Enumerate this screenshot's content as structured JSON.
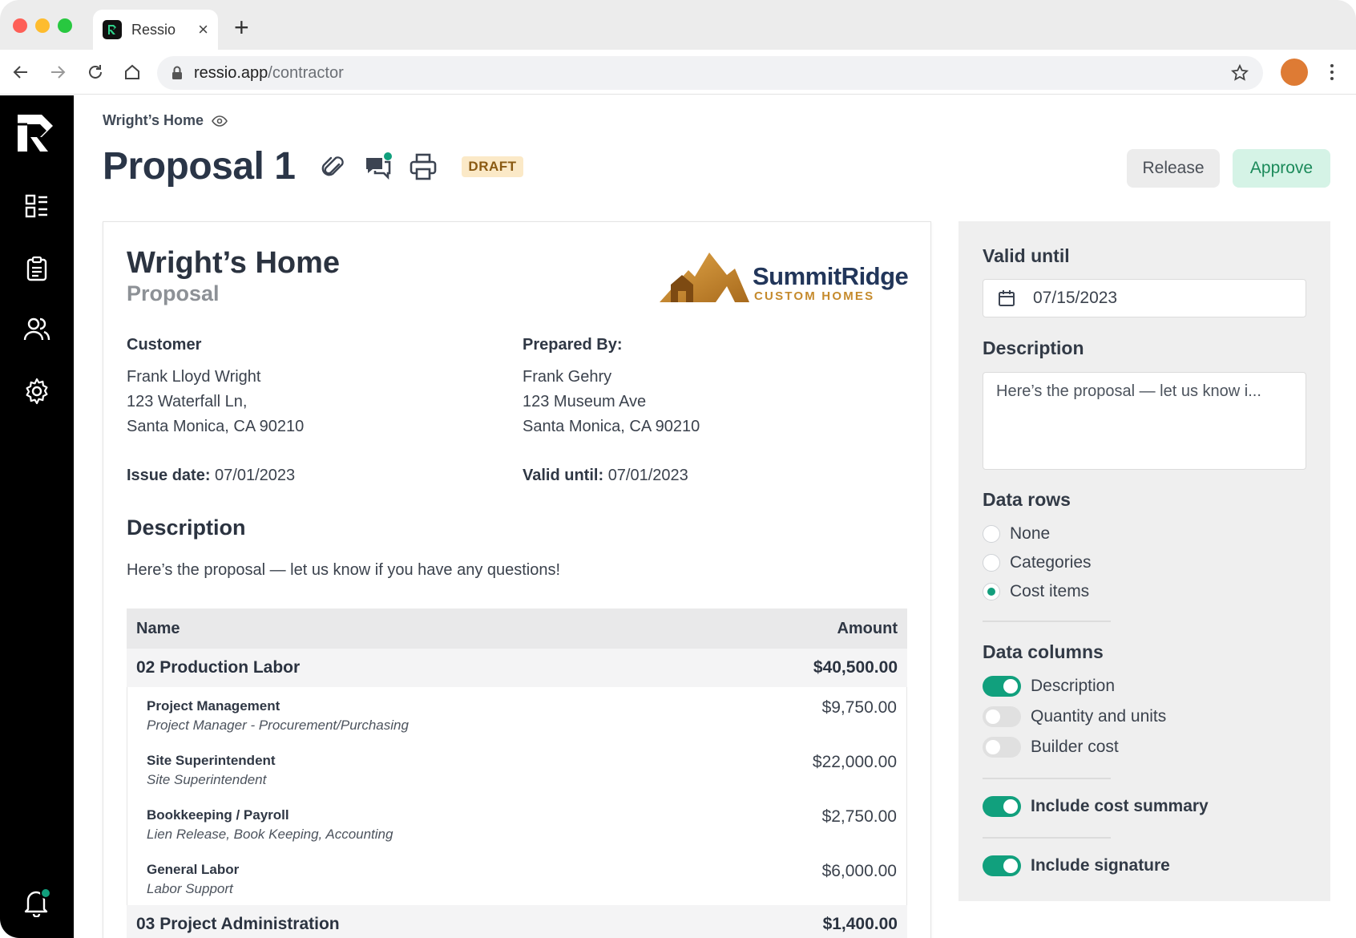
{
  "browser": {
    "tab_title": "Ressio",
    "url_domain": "ressio.app",
    "url_path": "/contractor"
  },
  "header": {
    "breadcrumb": "Wright’s Home",
    "title": "Proposal 1",
    "status_badge": "DRAFT",
    "release_label": "Release",
    "approve_label": "Approve"
  },
  "document": {
    "title": "Wright’s Home",
    "subtitle": "Proposal",
    "logo_name": "SummitRidge",
    "logo_tagline": "CUSTOM HOMES",
    "customer_heading": "Customer",
    "customer_lines": [
      "Frank Lloyd Wright",
      "123 Waterfall Ln,",
      "Santa Monica, CA 90210"
    ],
    "prepared_heading": "Prepared By:",
    "prepared_lines": [
      "Frank Gehry",
      "123 Museum Ave",
      "Santa Monica, CA 90210"
    ],
    "issue_date_label": "Issue date:",
    "issue_date": "07/01/2023",
    "valid_until_label": "Valid until:",
    "valid_until": "07/01/2023",
    "description_heading": "Description",
    "description": "Here’s the proposal — let us know if you have any questions!",
    "table": {
      "col_name": "Name",
      "col_amount": "Amount",
      "categories": [
        {
          "name": "02 Production Labor",
          "amount": "$40,500.00",
          "items": [
            {
              "name": "Project Management",
              "desc": "Project Manager - Procurement/Purchasing",
              "amount": "$9,750.00"
            },
            {
              "name": "Site Superintendent",
              "desc": "Site Superintendent",
              "amount": "$22,000.00"
            },
            {
              "name": "Bookkeeping / Payroll",
              "desc": "Lien Release, Book Keeping, Accounting",
              "amount": "$2,750.00"
            },
            {
              "name": "General Labor",
              "desc": "Labor Support",
              "amount": "$6,000.00"
            }
          ]
        },
        {
          "name": "03 Project Administration",
          "amount": "$1,400.00",
          "items": []
        }
      ]
    }
  },
  "panel": {
    "valid_until_heading": "Valid until",
    "valid_until_value": "07/15/2023",
    "description_heading": "Description",
    "description_value": "Here’s the proposal — let us know i...",
    "data_rows_heading": "Data rows",
    "data_rows_options": [
      "None",
      "Categories",
      "Cost items"
    ],
    "data_rows_selected": "Cost items",
    "data_columns_heading": "Data columns",
    "data_columns": [
      {
        "label": "Description",
        "on": true
      },
      {
        "label": "Quantity and units",
        "on": false
      },
      {
        "label": "Builder cost",
        "on": false
      }
    ],
    "include_cost_summary": {
      "label": "Include cost summary",
      "on": true
    },
    "include_signature": {
      "label": "Include signature",
      "on": true
    }
  },
  "colors": {
    "accent": "#11a07d",
    "approve_bg": "#d5f3e6",
    "draft_bg": "#fbe9c7",
    "sidebar_bg": "#000000",
    "avatar": "#de7b34"
  },
  "icons": [
    "paperclip-icon",
    "chat-icon",
    "print-icon",
    "eye-icon",
    "calendar-icon",
    "dashboard-icon",
    "clipboard-icon",
    "users-icon",
    "gear-icon",
    "bell-icon"
  ]
}
